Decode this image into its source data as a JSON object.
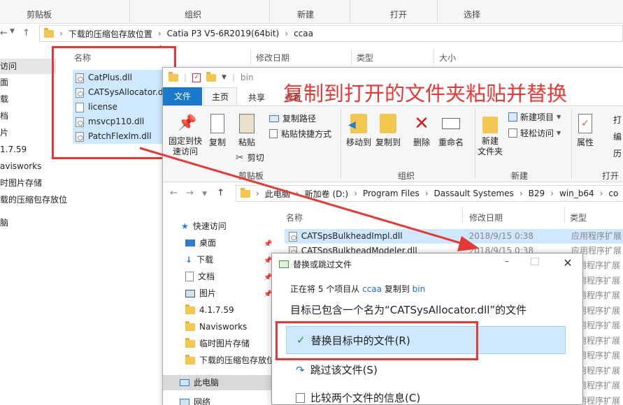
{
  "back_window": {
    "ribbon_groups": [
      "剪贴板",
      "组织",
      "新建",
      "打开",
      "选择"
    ],
    "breadcrumb": [
      "下载的压缩包存放位置",
      "Catia P3 V5-6R2019(64bit)",
      "ccaa"
    ],
    "columns": [
      "名称",
      "修改日期",
      "类型",
      "大小"
    ],
    "files": [
      "CatPlus.dll",
      "CATSysAllocator.dll",
      "license",
      "msvcp110.dll",
      "PatchFlexlm.dll"
    ],
    "nav_items": [
      "访问",
      "面",
      "载",
      "档",
      "片",
      "1.7.59",
      "avisworks",
      "时图片存储",
      "载的压缩包存放位",
      "脑"
    ]
  },
  "front_window": {
    "qat_title": "bin",
    "tabs": [
      "文件",
      "主页",
      "共享",
      "查看"
    ],
    "annotation": "复制到打开的文件夹粘贴并替换",
    "ribbon": {
      "pin": "固定到快\n速访问",
      "copy": "复制",
      "paste": "粘贴",
      "copy_path": "复制路径",
      "paste_shortcut": "粘贴快捷方式",
      "cut": "剪切",
      "move_to": "移动到",
      "copy_to": "复制到",
      "delete": "删除",
      "rename": "重命名",
      "new_folder": "新建\n文件夹",
      "new_item": "新建项目",
      "easy_access": "轻松访问",
      "properties": "属性",
      "open_partial": "打",
      "edit_partial": "编",
      "history_partial": "历",
      "groups": [
        "剪贴板",
        "组织",
        "新建",
        "打开"
      ]
    },
    "breadcrumb": [
      "此电脑",
      "新加卷 (D:)",
      "Program Files",
      "Dassault Systemes",
      "B29",
      "win_b64",
      "co"
    ],
    "columns": [
      "名称",
      "修改日期",
      "类型"
    ],
    "files": [
      {
        "name": "CATSpsBulkheadImpl.dll",
        "date": "2018/9/15 0:38",
        "type": "应用程序扩展"
      },
      {
        "name": "CATSpsBulkheadModeler.dll",
        "date": "2018/9/15 0:38",
        "type": "应用程序扩展"
      }
    ],
    "extra_types": [
      "应用程序扩展",
      "应用程序扩展",
      "应用程序扩展",
      "应用程序扩展",
      "应用程序扩展",
      "应用程序扩展",
      "应用程序扩展",
      "应用程序扩展",
      "应用程序扩展",
      "应用程序扩展"
    ],
    "nav": [
      "快速访问",
      "桌面",
      "下载",
      "文档",
      "图片",
      "4.1.7.59",
      "Navisworks",
      "临时图片存储",
      "下载的压缩包存放位",
      "此电脑",
      "网络"
    ]
  },
  "dialog": {
    "title": "替换或跳过文件",
    "line1_pre": "正在将 5 个项目从",
    "line1_src": "ccaa",
    "line1_mid": "复制到",
    "line1_dst": "bin",
    "line2": "目标已包含一个名为“CATSysAllocator.dll”的文件",
    "opt_replace": "替换目标中的文件(R)",
    "opt_skip": "跳过该文件(S)",
    "opt_compare": "比较两个文件的信息(C)"
  }
}
